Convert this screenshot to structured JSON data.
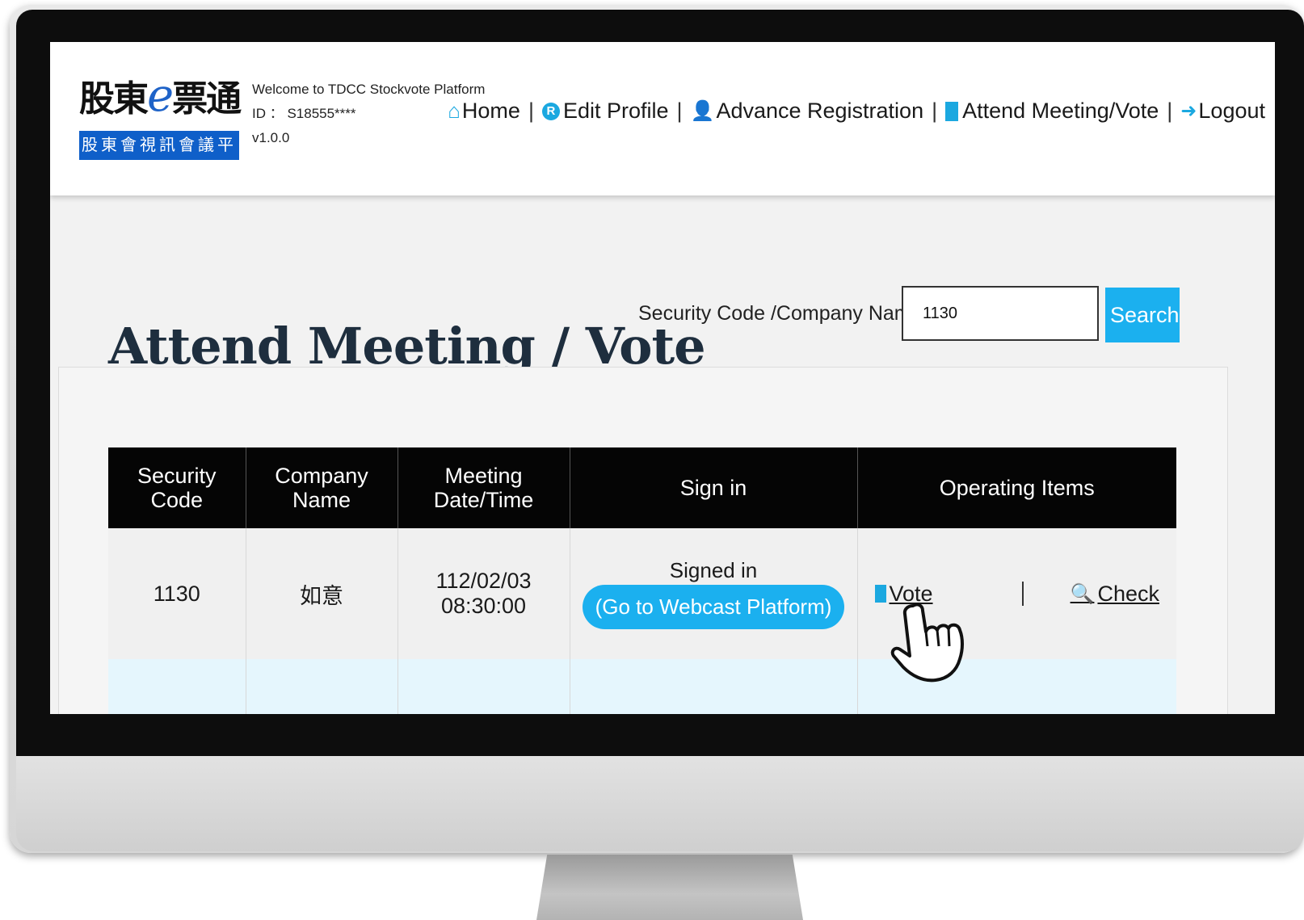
{
  "header": {
    "logo_main": "股東",
    "logo_e": "e",
    "logo_main2": "票通",
    "logo_sub": "股東會視訊會議平台",
    "welcome": "Welcome to TDCC Stockvote Platform",
    "id_line": "ID ： S18555****",
    "version": "v1.0.0"
  },
  "nav": {
    "home": "Home",
    "edit_profile": "Edit Profile",
    "advance_registration": "Advance Registration",
    "attend_meeting": "Attend Meeting/Vote",
    "logout": "Logout",
    "separator": "|"
  },
  "page": {
    "title": "Attend Meeting / Vote",
    "search_label": "Security Code /Company Name",
    "search_colon": ":",
    "search_value": "1130",
    "search_button": "Search"
  },
  "table": {
    "headers": {
      "security_code": "Security Code",
      "company_name": "Company Name",
      "meeting_datetime": "Meeting Date/Time",
      "sign_in": "Sign in",
      "operating_items": "Operating Items"
    },
    "rows": [
      {
        "security_code": "1130",
        "company_name": "如意",
        "meeting_datetime": "112/02/03 08:30:00",
        "sign_in_status": "Signed in",
        "webcast_button": "(Go to Webcast Platform)",
        "vote_label": "Vote",
        "check_label": "Check"
      }
    ]
  },
  "icons": {
    "home": "home-icon",
    "edit_profile": "r-badge-icon",
    "advance_registration": "user-plus-icon",
    "attend_meeting": "document-icon",
    "logout": "logout-icon",
    "info": "info-icon",
    "vote": "vote-doc-icon",
    "check": "search-icon",
    "cursor": "hand-pointer-icon"
  },
  "colors": {
    "accent": "#1bb0ef",
    "table_header": "#050505",
    "logo_blue": "#0f5fc9"
  }
}
